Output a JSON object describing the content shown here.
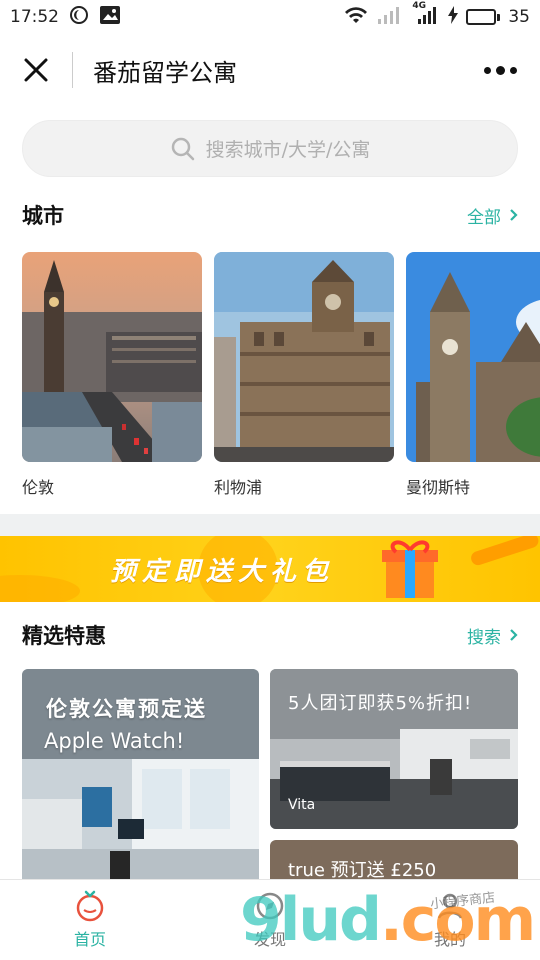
{
  "status_bar": {
    "time": "17:52",
    "network": "4G",
    "battery": "35",
    "battery_level": 0.35
  },
  "nav": {
    "title": "番茄留学公寓"
  },
  "search": {
    "placeholder": "搜索城市/大学/公寓"
  },
  "cities_section": {
    "title": "城市",
    "more_label": "全部",
    "items": [
      {
        "name": "伦敦"
      },
      {
        "name": "利物浦"
      },
      {
        "name": "曼彻斯特"
      }
    ]
  },
  "banner": {
    "text": "预定即送大礼包"
  },
  "deals_section": {
    "title": "精选特惠",
    "more_label": "搜索",
    "items": [
      {
        "line1": "伦敦公寓预定送",
        "line2": "Apple Watch!"
      },
      {
        "line1": "5人团订即获5%折扣!",
        "line2": "Vita"
      },
      {
        "line1": "true 预订送 £250"
      }
    ]
  },
  "tabbar": {
    "items": [
      {
        "label": "首页"
      },
      {
        "label": "发现"
      },
      {
        "label": "我的"
      }
    ]
  },
  "watermark": {
    "main": "9lud",
    "suffix": ".com",
    "sub": "小程序商店"
  },
  "colors": {
    "accent": "#2bb3a3",
    "banner": "#ffc700",
    "separator": "#eff1f2"
  }
}
